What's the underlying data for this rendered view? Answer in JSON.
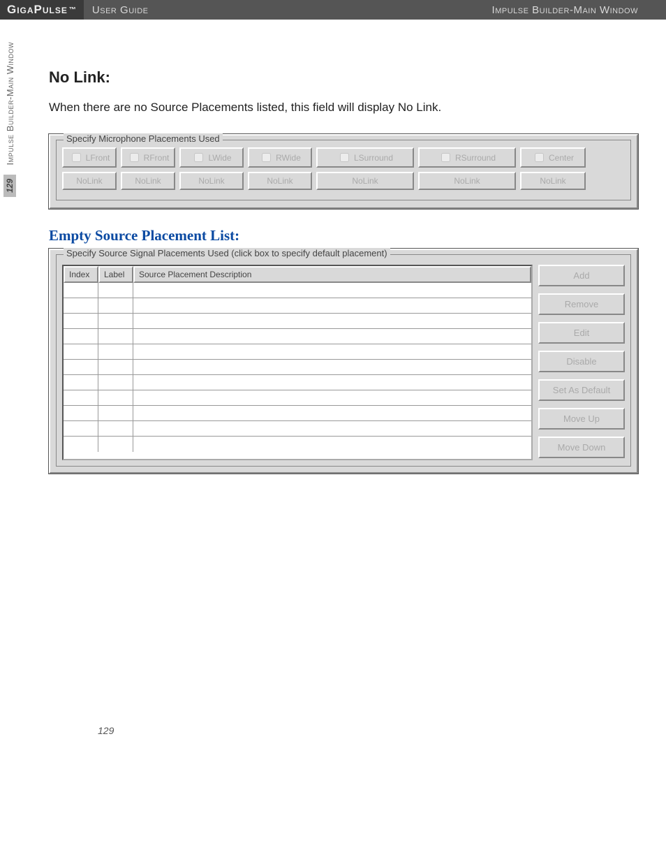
{
  "header": {
    "product": "GigaPulse",
    "trademark": "™",
    "guide": "User Guide",
    "section": "Impulse Builder-Main Window"
  },
  "sidebar": {
    "label": "Impulse Builder-Main Window",
    "page": "129"
  },
  "section_nolink": {
    "title": "No Link:",
    "paragraph": "When there are no Source Placements listed, this field will display No Link."
  },
  "mic_panel": {
    "legend": "Specify Microphone Placements Used",
    "checks": [
      "LFront",
      "RFront",
      "LWide",
      "RWide",
      "LSurround",
      "RSurround",
      "Center"
    ],
    "buttons": [
      "NoLink",
      "NoLink",
      "NoLink",
      "NoLink",
      "NoLink",
      "NoLink",
      "NoLink"
    ]
  },
  "section_empty": {
    "title": "Empty Source Placement List:"
  },
  "src_panel": {
    "legend": "Specify Source Signal Placements Used (click box to specify default placement)",
    "columns": {
      "index": "Index",
      "label": "Label",
      "desc": "Source Placement Description"
    },
    "buttons": [
      "Add",
      "Remove",
      "Edit",
      "Disable",
      "Set As Default",
      "Move Up",
      "Move Down"
    ]
  },
  "footer": {
    "page": "129"
  }
}
